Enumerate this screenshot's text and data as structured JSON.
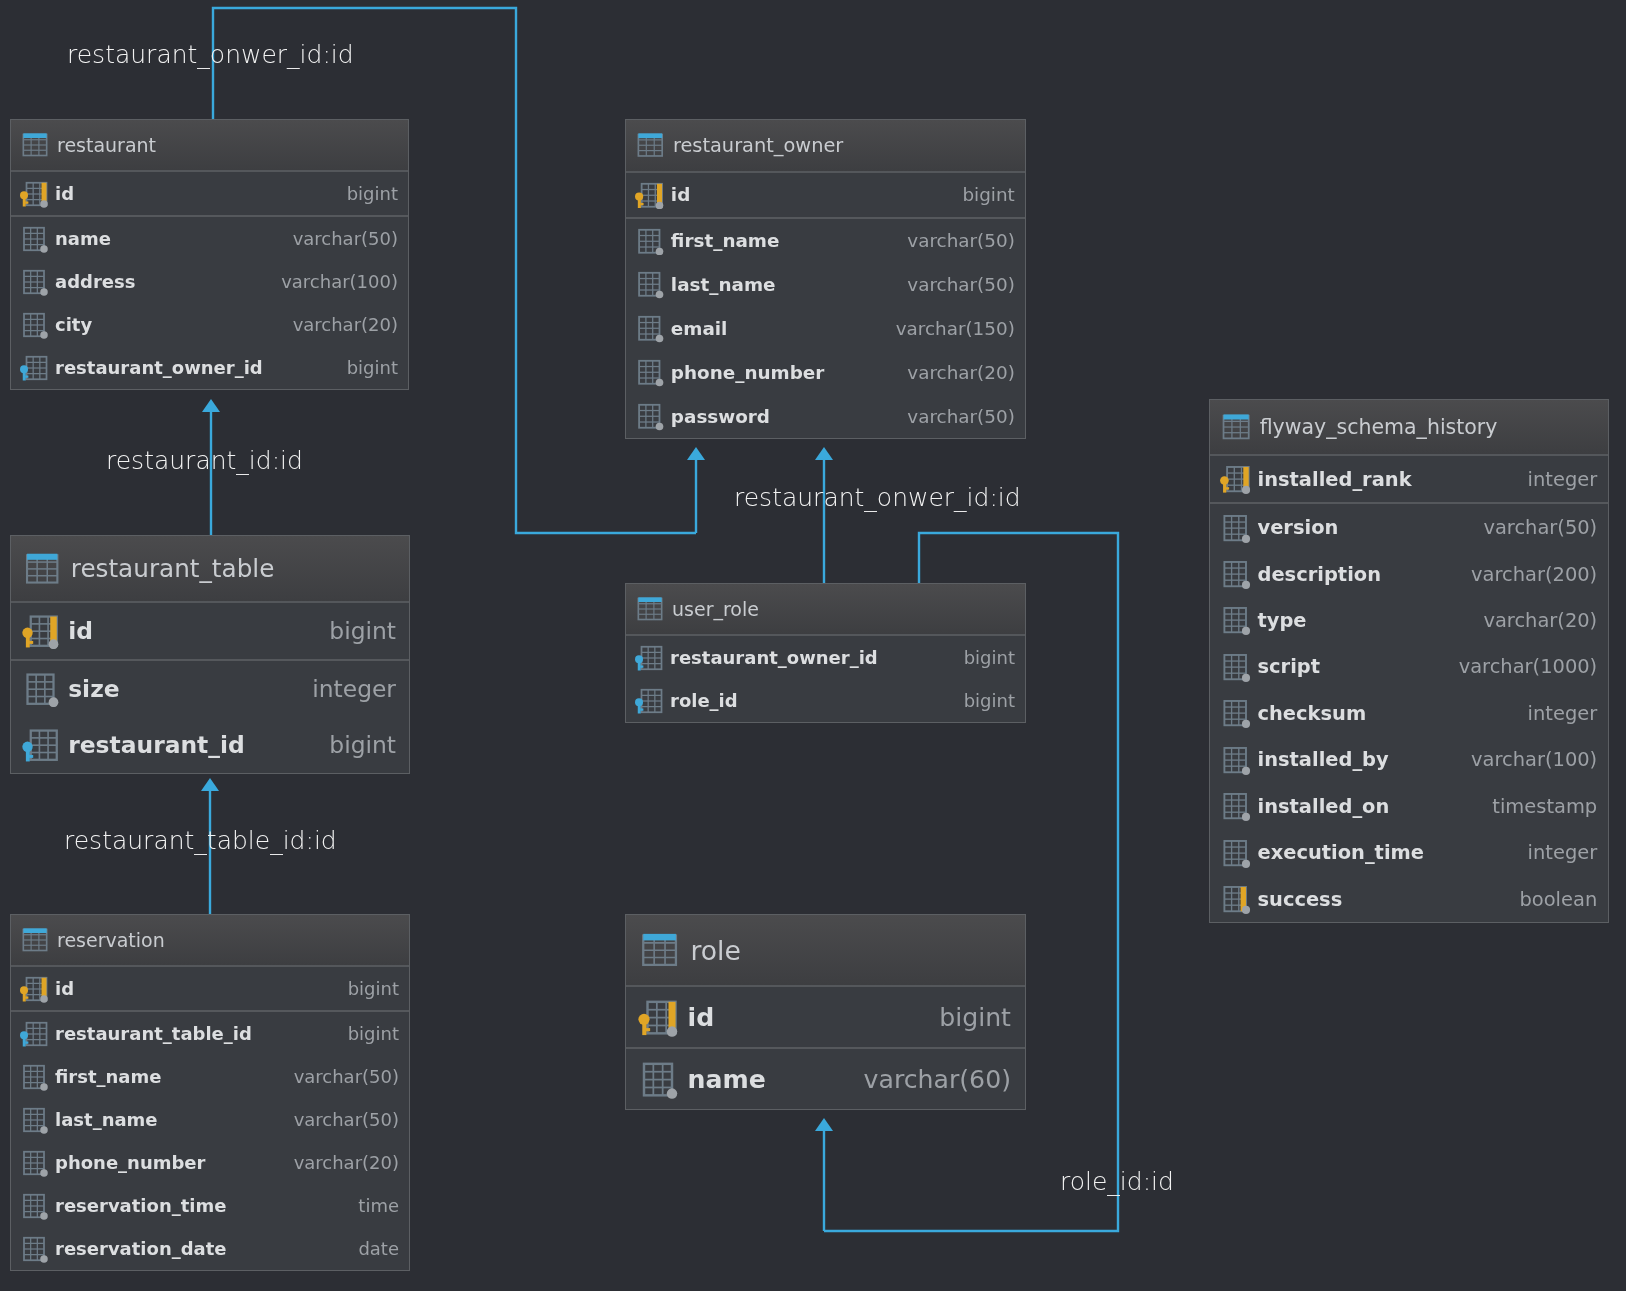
{
  "tables": [
    {
      "name": "restaurant",
      "columns": [
        {
          "name": "id",
          "type": "bigint",
          "kind": "pk"
        },
        {
          "name": "name",
          "type": "varchar(50)",
          "kind": "column"
        },
        {
          "name": "address",
          "type": "varchar(100)",
          "kind": "column"
        },
        {
          "name": "city",
          "type": "varchar(20)",
          "kind": "column"
        },
        {
          "name": "restaurant_owner_id",
          "type": "bigint",
          "kind": "fk"
        }
      ]
    },
    {
      "name": "restaurant_table",
      "columns": [
        {
          "name": "id",
          "type": "bigint",
          "kind": "pk"
        },
        {
          "name": "size",
          "type": "integer",
          "kind": "column"
        },
        {
          "name": "restaurant_id",
          "type": "bigint",
          "kind": "fk"
        }
      ]
    },
    {
      "name": "reservation",
      "columns": [
        {
          "name": "id",
          "type": "bigint",
          "kind": "pk"
        },
        {
          "name": "restaurant_table_id",
          "type": "bigint",
          "kind": "fk"
        },
        {
          "name": "first_name",
          "type": "varchar(50)",
          "kind": "column"
        },
        {
          "name": "last_name",
          "type": "varchar(50)",
          "kind": "column"
        },
        {
          "name": "phone_number",
          "type": "varchar(20)",
          "kind": "column"
        },
        {
          "name": "reservation_time",
          "type": "time",
          "kind": "column"
        },
        {
          "name": "reservation_date",
          "type": "date",
          "kind": "column"
        }
      ]
    },
    {
      "name": "restaurant_owner",
      "columns": [
        {
          "name": "id",
          "type": "bigint",
          "kind": "pk"
        },
        {
          "name": "first_name",
          "type": "varchar(50)",
          "kind": "column"
        },
        {
          "name": "last_name",
          "type": "varchar(50)",
          "kind": "column"
        },
        {
          "name": "email",
          "type": "varchar(150)",
          "kind": "column"
        },
        {
          "name": "phone_number",
          "type": "varchar(20)",
          "kind": "column"
        },
        {
          "name": "password",
          "type": "varchar(50)",
          "kind": "column"
        }
      ]
    },
    {
      "name": "user_role",
      "columns": [
        {
          "name": "restaurant_owner_id",
          "type": "bigint",
          "kind": "fk"
        },
        {
          "name": "role_id",
          "type": "bigint",
          "kind": "fk"
        }
      ]
    },
    {
      "name": "role",
      "columns": [
        {
          "name": "id",
          "type": "bigint",
          "kind": "pk"
        },
        {
          "name": "name",
          "type": "varchar(60)",
          "kind": "column"
        }
      ]
    },
    {
      "name": "flyway_schema_history",
      "columns": [
        {
          "name": "installed_rank",
          "type": "integer",
          "kind": "pk"
        },
        {
          "name": "version",
          "type": "varchar(50)",
          "kind": "column"
        },
        {
          "name": "description",
          "type": "varchar(200)",
          "kind": "column"
        },
        {
          "name": "type",
          "type": "varchar(20)",
          "kind": "column"
        },
        {
          "name": "script",
          "type": "varchar(1000)",
          "kind": "column"
        },
        {
          "name": "checksum",
          "type": "integer",
          "kind": "column"
        },
        {
          "name": "installed_by",
          "type": "varchar(100)",
          "kind": "column"
        },
        {
          "name": "installed_on",
          "type": "timestamp",
          "kind": "column"
        },
        {
          "name": "execution_time",
          "type": "integer",
          "kind": "column"
        },
        {
          "name": "success",
          "type": "boolean",
          "kind": "index"
        }
      ]
    }
  ],
  "relations": [
    {
      "label": "restaurant_onwer_id:id"
    },
    {
      "label": "restaurant_id:id"
    },
    {
      "label": "restaurant_onwer_id:id"
    },
    {
      "label": "restaurant_table_id:id"
    },
    {
      "label": "role_id:id"
    }
  ]
}
